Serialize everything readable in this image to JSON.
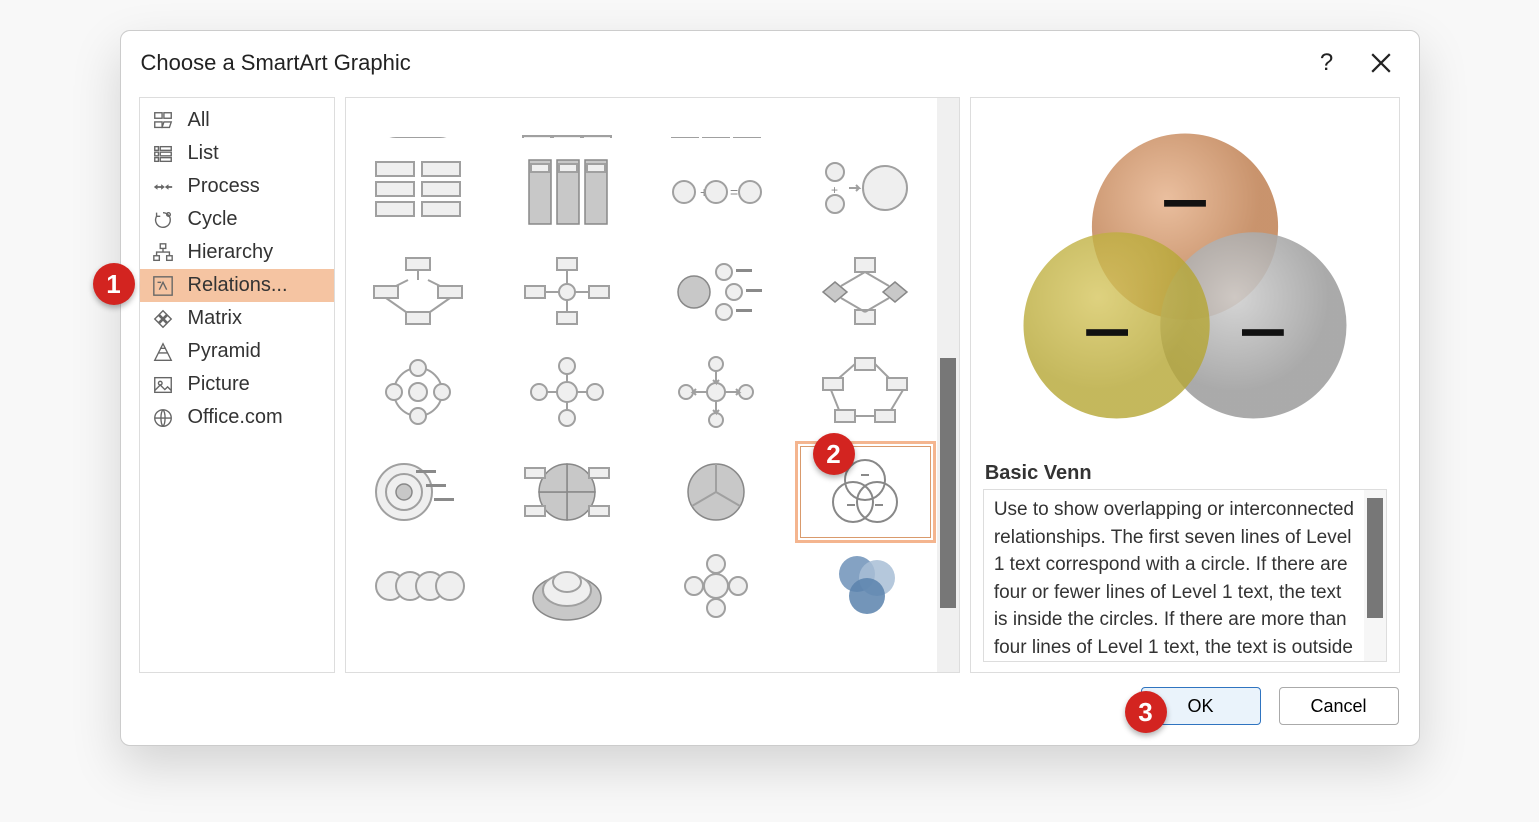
{
  "dialog": {
    "title": "Choose a SmartArt Graphic",
    "help": "?"
  },
  "sidebar": {
    "items": [
      {
        "label": "All"
      },
      {
        "label": "List"
      },
      {
        "label": "Process"
      },
      {
        "label": "Cycle"
      },
      {
        "label": "Hierarchy"
      },
      {
        "label": "Relations..."
      },
      {
        "label": "Matrix"
      },
      {
        "label": "Pyramid"
      },
      {
        "label": "Picture"
      },
      {
        "label": "Office.com"
      }
    ],
    "selected_index": 5
  },
  "gallery": {
    "selected_name": "basic-venn"
  },
  "preview": {
    "title": "Basic Venn",
    "description": "Use to show overlapping or interconnected relationships. The first seven lines of Level 1 text correspond with a circle. If there are four or fewer lines of Level 1 text, the text is inside the circles. If there are more than four lines of Level 1 text, the text is outside of the circles"
  },
  "buttons": {
    "ok": "OK",
    "cancel": "Cancel"
  },
  "annotations": {
    "b1": "1",
    "b2": "2",
    "b3": "3"
  }
}
